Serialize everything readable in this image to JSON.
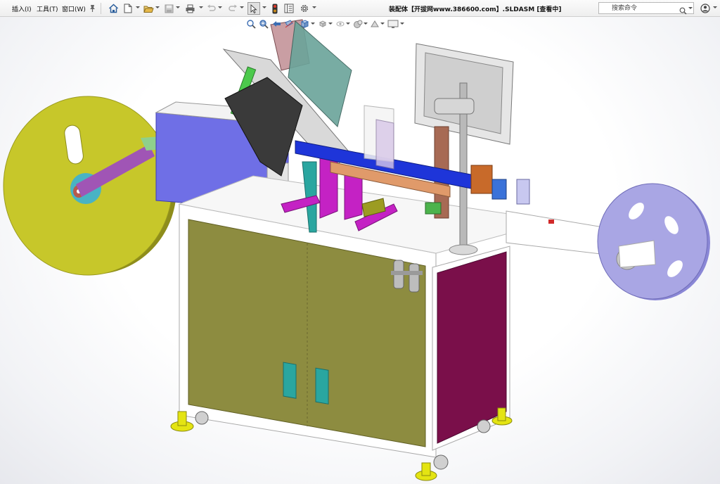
{
  "menu": {
    "items": [
      {
        "id": "insert",
        "label": "插入(I)"
      },
      {
        "id": "tools",
        "label": "工具(T)"
      },
      {
        "id": "window",
        "label": "窗口(W)"
      }
    ]
  },
  "toolbar": {
    "buttons": [
      "pin-icon",
      "home-icon",
      "new-document-icon",
      "open-icon",
      "save-icon",
      "print-icon",
      "undo-icon",
      "redo-icon",
      "select-icon",
      "traffic-light-icon",
      "properties-icon",
      "options-gear-icon"
    ]
  },
  "document": {
    "title": "装配体【开拔网www.386600.com】.SLDASM [查看中]"
  },
  "search": {
    "placeholder": "搜索命令"
  },
  "heads_up": {
    "buttons": [
      "zoom-to-fit-icon",
      "zoom-area-icon",
      "previous-view-icon",
      "section-view-icon",
      "view-orientation-icon",
      "display-style-icon",
      "hide-show-icon",
      "edit-appearance-icon",
      "apply-scene-icon",
      "view-settings-icon"
    ]
  },
  "colors": {
    "reel_left": "#c7c72a",
    "reel_right": "#a9a6e4",
    "cabinet_door": "#8d8c40",
    "side_panel": "#7a0f4a",
    "body_blue": "#6f6fe6",
    "feet": "#e4e412",
    "teal": "#2aa6a0",
    "magenta": "#c422c4"
  }
}
